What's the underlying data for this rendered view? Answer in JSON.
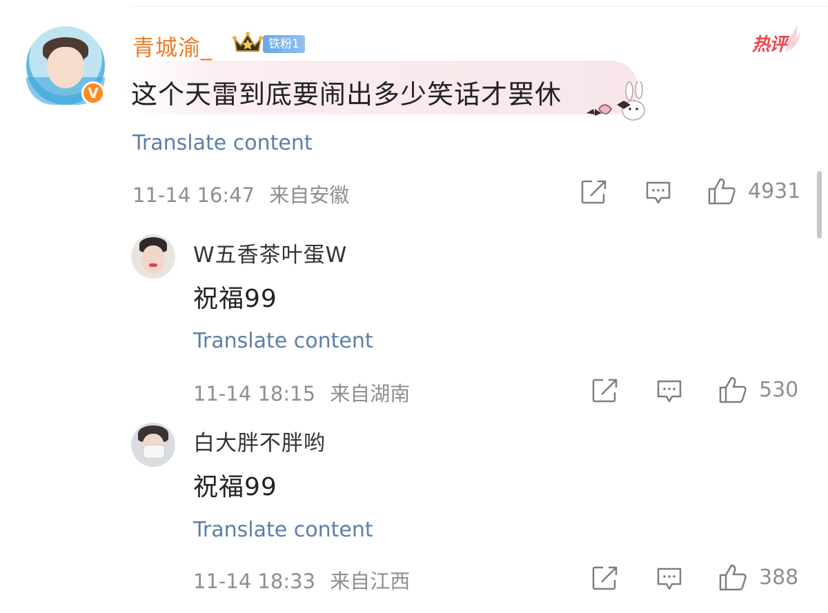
{
  "main_comment": {
    "username": "青城渝_",
    "fan_badge": "铁粉1",
    "hot_label": "热评",
    "verified_mark": "V",
    "text": "这个天雷到底要闹出多少笑话才罢休",
    "translate_label": "Translate content",
    "timestamp": "11-14 16:47",
    "location": "来自安徽",
    "likes": "4931"
  },
  "replies": [
    {
      "username": "W五香茶叶蛋W",
      "text": "祝福99",
      "translate_label": "Translate content",
      "timestamp": "11-14 18:15",
      "location": "来自湖南",
      "likes": "530"
    },
    {
      "username": "白大胖不胖哟",
      "text": "祝福99",
      "translate_label": "Translate content",
      "timestamp": "11-14 18:33",
      "location": "来自江西",
      "likes": "388"
    }
  ],
  "icons": {
    "share": "share-icon",
    "comment": "comment-icon",
    "like": "thumbs-up-icon",
    "crown": "crown-icon",
    "verified": "verified-badge-icon"
  },
  "colors": {
    "username_vip": "#f07b2b",
    "link": "#5b7fa8",
    "meta": "#8e8e8e",
    "hot": "#e9474e",
    "fan_badge": "#6aa8e8",
    "verified": "#ff8a1f"
  }
}
